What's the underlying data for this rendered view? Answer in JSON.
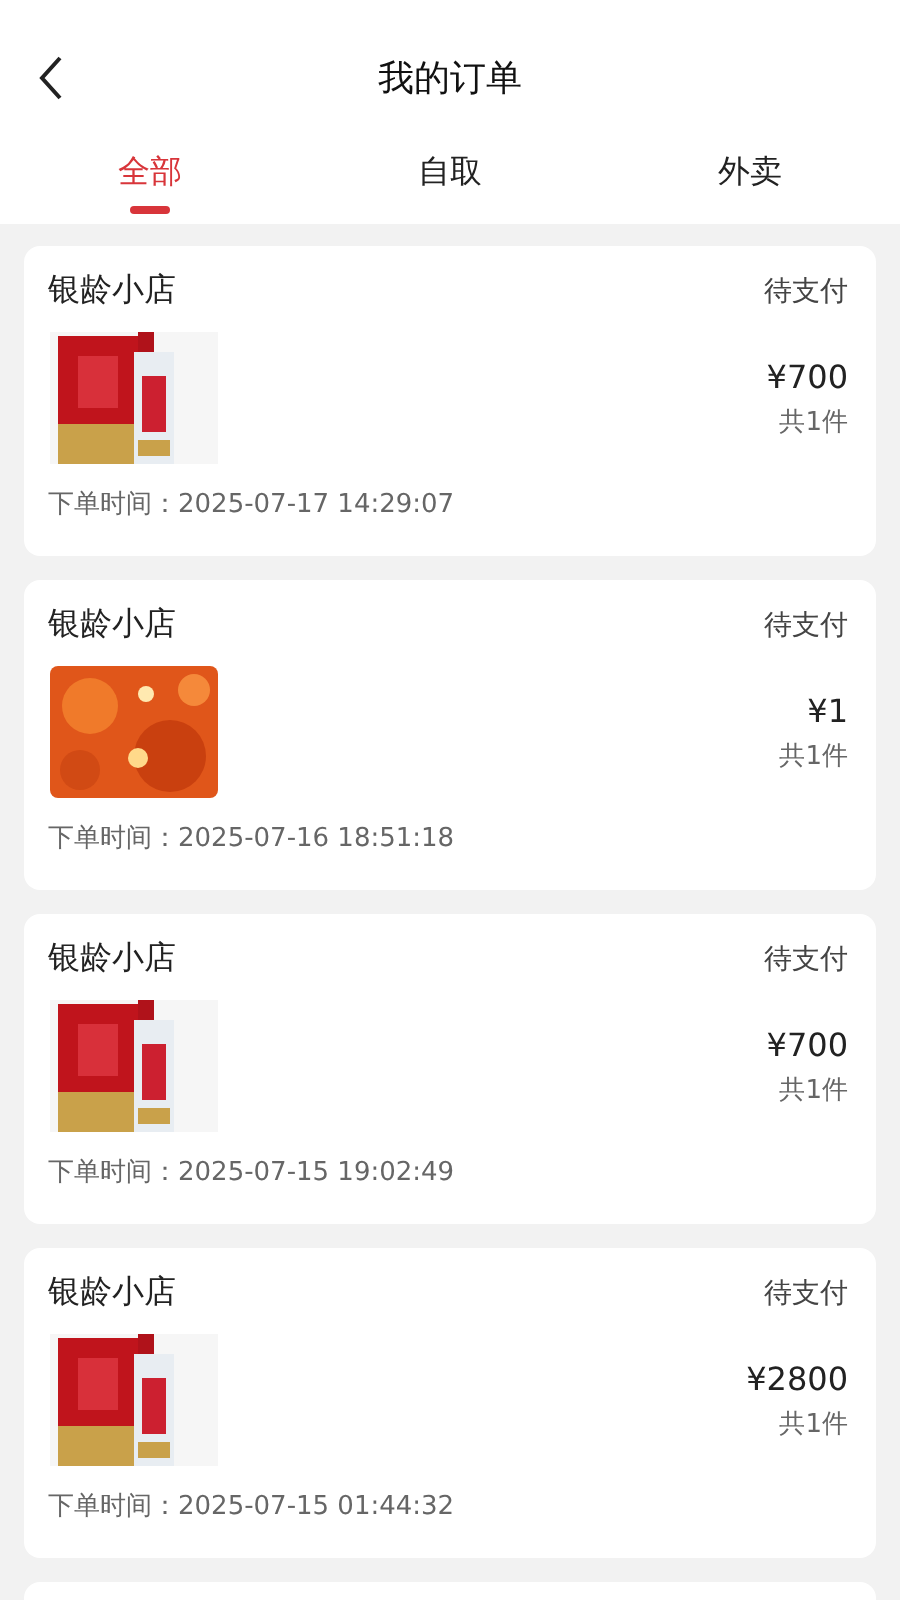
{
  "header": {
    "title": "我的订单"
  },
  "tabs": [
    {
      "label": "全部",
      "selected": true
    },
    {
      "label": "自取",
      "selected": false
    },
    {
      "label": "外卖",
      "selected": false
    }
  ],
  "orders": [
    {
      "store": "银龄小店",
      "status": "待支付",
      "price": "¥700",
      "count": "共1件",
      "time": "下单时间：2025-07-17 14:29:07"
    },
    {
      "store": "银龄小店",
      "status": "待支付",
      "price": "¥1",
      "count": "共1件",
      "time": "下单时间：2025-07-16 18:51:18"
    },
    {
      "store": "银龄小店",
      "status": "待支付",
      "price": "¥700",
      "count": "共1件",
      "time": "下单时间：2025-07-15 19:02:49"
    },
    {
      "store": "银龄小店",
      "status": "待支付",
      "price": "¥2800",
      "count": "共1件",
      "time": "下单时间：2025-07-15 01:44:32"
    }
  ]
}
